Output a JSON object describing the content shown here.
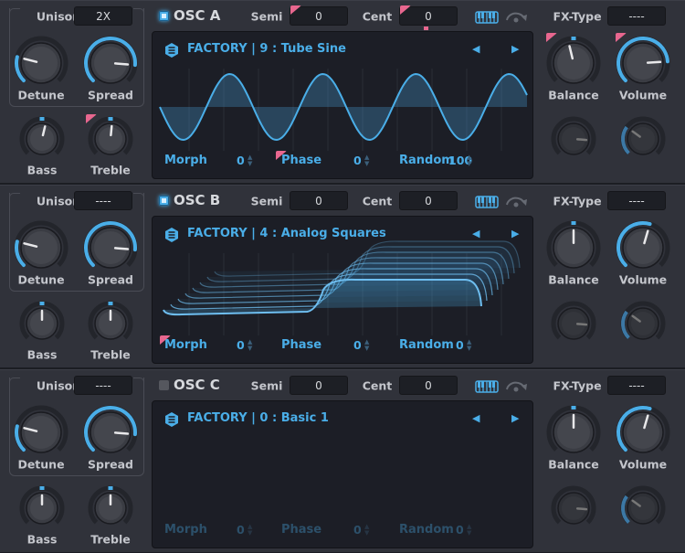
{
  "colors": {
    "accent": "#4aaee8",
    "background": "#30323a",
    "display": "#1c1e26",
    "mod": "#e8678f",
    "text": "#c4c6cc"
  },
  "labels": {
    "unison": "Unison",
    "semi": "Semi",
    "cent": "Cent",
    "fx_type": "FX-Type",
    "detune": "Detune",
    "spread": "Spread",
    "bass": "Bass",
    "treble": "Treble",
    "balance": "Balance",
    "volume": "Volume",
    "morph": "Morph",
    "phase": "Phase",
    "random": "Random"
  },
  "icons": {
    "enable": "checkbox-icon",
    "keytrack": "keyboard-icon",
    "retrigger": "retrigger-arc-icon",
    "browser": "hexagon-list-icon",
    "prev": "triangle-left-icon",
    "next": "triangle-right-icon",
    "mod": "modulation-badge-icon"
  },
  "oscillators": [
    {
      "name": "OSC A",
      "enabled": true,
      "unison": "2X",
      "semi": "0",
      "cent": "0",
      "fx_type": "----",
      "preset": "FACTORY | 9 : Tube Sine",
      "waveform": "sine",
      "morph": "0",
      "phase": "0",
      "random": "100",
      "knobs": {
        "detune": 0.22,
        "spread": 0.85,
        "bass": 0.55,
        "treble": 0.52,
        "balance": 0.45,
        "volume": 0.82,
        "fx1": 0.85,
        "fx2": 0.3
      },
      "mod": [
        "semi",
        "cent",
        "treble",
        "phase",
        "balance",
        "volume"
      ]
    },
    {
      "name": "OSC B",
      "enabled": true,
      "unison": "----",
      "semi": "0",
      "cent": "0",
      "fx_type": "----",
      "preset": "FACTORY | 4 : Analog Squares",
      "waveform": "squares",
      "morph": "0",
      "phase": "0",
      "random": "0",
      "knobs": {
        "detune": 0.22,
        "spread": 0.85,
        "bass": 0.5,
        "treble": 0.5,
        "balance": 0.5,
        "volume": 0.56,
        "fx1": 0.85,
        "fx2": 0.3
      },
      "mod": [
        "morph"
      ]
    },
    {
      "name": "OSC C",
      "enabled": false,
      "unison": "----",
      "semi": "0",
      "cent": "0",
      "fx_type": "----",
      "preset": "FACTORY | 0 : Basic 1",
      "waveform": "none",
      "morph": "0",
      "phase": "0",
      "random": "0",
      "knobs": {
        "detune": 0.22,
        "spread": 0.85,
        "bass": 0.5,
        "treble": 0.5,
        "balance": 0.5,
        "volume": 0.56,
        "fx1": 0.85,
        "fx2": 0.3
      },
      "mod": []
    }
  ]
}
